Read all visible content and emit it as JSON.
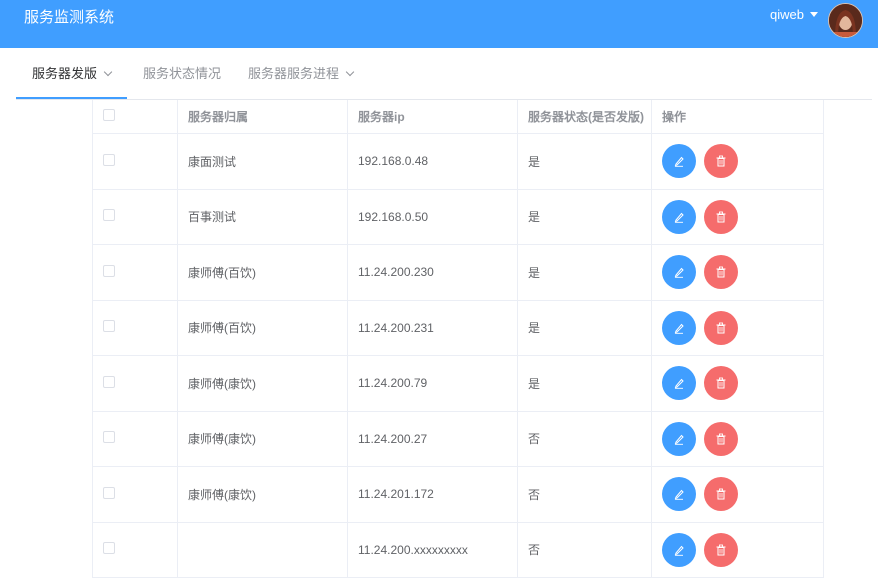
{
  "header": {
    "title": "服务监测系统",
    "user": "qiweb"
  },
  "menu": [
    {
      "label": "服务器发版",
      "dropdown": true,
      "active": true
    },
    {
      "label": "服务状态情况",
      "dropdown": false,
      "active": false
    },
    {
      "label": "服务器服务进程",
      "dropdown": true,
      "active": false
    }
  ],
  "table": {
    "columns": [
      "服务器归属",
      "服务器ip",
      "服务器状态(是否发版)",
      "操作"
    ],
    "rows": [
      {
        "owner": "康面测试",
        "ip": "192.168.0.48",
        "status": "是"
      },
      {
        "owner": "百事测试",
        "ip": "192.168.0.50",
        "status": "是"
      },
      {
        "owner": "康师傅(百饮)",
        "ip": "11.24.200.230",
        "status": "是"
      },
      {
        "owner": "康师傅(百饮)",
        "ip": "11.24.200.231",
        "status": "是"
      },
      {
        "owner": "康师傅(康饮)",
        "ip": "11.24.200.79",
        "status": "是"
      },
      {
        "owner": "康师傅(康饮)",
        "ip": "11.24.200.27",
        "status": "否"
      },
      {
        "owner": "康师傅(康饮)",
        "ip": "11.24.201.172",
        "status": "否"
      },
      {
        "owner": "",
        "ip": "11.24.200.xxxxxxxxx",
        "status": "否"
      }
    ]
  },
  "colors": {
    "header": "#409eff",
    "edit_button": "#409eff",
    "delete_button": "#f56c6c"
  },
  "icons": {
    "edit": "edit-icon",
    "delete": "trash-icon"
  }
}
